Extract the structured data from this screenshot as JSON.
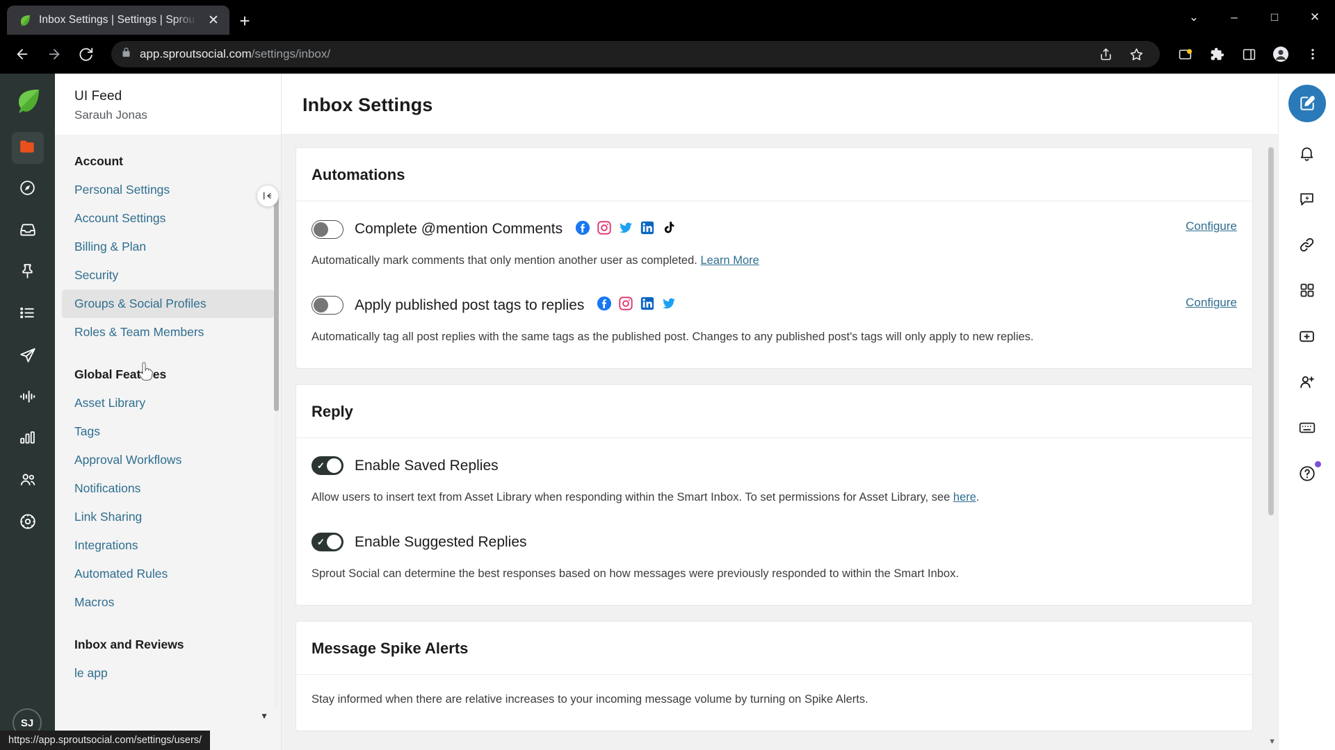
{
  "browser": {
    "tab": {
      "title": "Inbox Settings | Settings | Sprou",
      "favicon": "sprout-leaf-icon",
      "close_label": "✕"
    },
    "new_tab_label": "+",
    "window_controls": {
      "minimize_list": "⌄",
      "minimize": "–",
      "maximize": "□",
      "close": "✕"
    },
    "nav": {
      "back": "←",
      "forward": "→",
      "reload": "↻"
    },
    "omnibox": {
      "lock_icon": "lock-icon",
      "url_domain": "app.sproutsocial.com",
      "url_path": "/settings/inbox/",
      "share_icon": "share-icon",
      "bookmark_icon": "star-icon",
      "extensions_icon": "puzzle-icon",
      "sidepanel_icon": "side-panel-icon",
      "profile_icon": "profile-avatar-icon",
      "menu_icon": "three-dot-menu-icon"
    },
    "status_bar_url": "https://app.sproutsocial.com/settings/users/"
  },
  "left_rail": {
    "logo": "sprout-social-logo",
    "items": [
      {
        "name": "asset-folder",
        "icon": "orange-folder-icon",
        "active": true
      },
      {
        "name": "dashboard",
        "icon": "compass-icon",
        "active": false
      },
      {
        "name": "smart-inbox",
        "icon": "inbox-tray-icon",
        "active": false
      },
      {
        "name": "publishing",
        "icon": "pin-icon",
        "active": false
      },
      {
        "name": "tasks",
        "icon": "list-icon",
        "active": false
      },
      {
        "name": "send",
        "icon": "paper-plane-icon",
        "active": false
      },
      {
        "name": "listening",
        "icon": "audio-waveform-icon",
        "active": false
      },
      {
        "name": "reports",
        "icon": "bar-chart-icon",
        "active": false
      },
      {
        "name": "employee-advocacy",
        "icon": "people-icon",
        "active": false
      },
      {
        "name": "settings",
        "icon": "gear-circle-icon",
        "active": false
      }
    ],
    "avatar_initials": "SJ"
  },
  "settings_nav": {
    "org_name": "UI Feed",
    "user_name": "Sarauh Jonas",
    "collapse_icon": "collapse-panel-icon",
    "groups": [
      {
        "title": "Account",
        "items": [
          {
            "label": "Personal Settings",
            "active": false
          },
          {
            "label": "Account Settings",
            "active": false
          },
          {
            "label": "Billing & Plan",
            "active": false
          },
          {
            "label": "Security",
            "active": false
          },
          {
            "label": "Groups & Social Profiles",
            "active": true
          },
          {
            "label": "Roles & Team Members",
            "active": false
          }
        ]
      },
      {
        "title": "Global Features",
        "items": [
          {
            "label": "Asset Library",
            "active": false
          },
          {
            "label": "Tags",
            "active": false
          },
          {
            "label": "Approval Workflows",
            "active": false
          },
          {
            "label": "Notifications",
            "active": false
          },
          {
            "label": "Link Sharing",
            "active": false
          },
          {
            "label": "Integrations",
            "active": false
          },
          {
            "label": "Automated Rules",
            "active": false
          },
          {
            "label": "Macros",
            "active": false
          }
        ]
      },
      {
        "title": "Inbox and Reviews",
        "items": [
          {
            "label": "le app",
            "active": false
          }
        ]
      }
    ],
    "scroll_caret": "▼"
  },
  "main": {
    "page_title": "Inbox Settings",
    "cards": [
      {
        "title": "Automations",
        "rows": [
          {
            "label": "Complete @mention Comments",
            "toggle": "off",
            "networks": [
              "facebook",
              "instagram",
              "twitter",
              "linkedin",
              "tiktok"
            ],
            "description": "Automatically mark comments that only mention another user as completed.",
            "link_text": "Learn More",
            "action": "Configure"
          },
          {
            "label": "Apply published post tags to replies",
            "toggle": "off",
            "networks": [
              "facebook",
              "instagram",
              "linkedin",
              "twitter"
            ],
            "description": "Automatically tag all post replies with the same tags as the published post. Changes to any published post's tags will only apply to new replies.",
            "link_text": "",
            "action": "Configure"
          }
        ]
      },
      {
        "title": "Reply",
        "rows": [
          {
            "label": "Enable Saved Replies",
            "toggle": "on",
            "networks": [],
            "description": "Allow users to insert text from Asset Library when responding within the Smart Inbox. To set permissions for Asset Library, see",
            "link_text": "here",
            "description_suffix": ".",
            "action": ""
          },
          {
            "label": "Enable Suggested Replies",
            "toggle": "on",
            "networks": [],
            "description": "Sprout Social can determine the best responses based on how messages were previously responded to within the Smart Inbox.",
            "link_text": "",
            "action": ""
          }
        ]
      },
      {
        "title": "Message Spike Alerts",
        "rows": [
          {
            "label": "",
            "toggle": "",
            "networks": [],
            "description": "Stay informed when there are relative increases to your incoming message volume by turning on Spike Alerts.",
            "link_text": "",
            "action": ""
          }
        ]
      }
    ]
  },
  "right_rail": {
    "compose_icon": "compose-pencil-icon",
    "items": [
      {
        "name": "notifications",
        "icon": "bell-icon",
        "badge": false
      },
      {
        "name": "quick-reply",
        "icon": "lightning-chat-icon",
        "badge": false
      },
      {
        "name": "link-shortener",
        "icon": "link-chain-icon",
        "badge": false
      },
      {
        "name": "apps-grid",
        "icon": "grid-squares-icon",
        "badge": false
      },
      {
        "name": "add-item",
        "icon": "plus-box-icon",
        "badge": false
      },
      {
        "name": "invite-user",
        "icon": "person-plus-icon",
        "badge": false
      },
      {
        "name": "keyboard-shortcuts",
        "icon": "keyboard-icon",
        "badge": false
      },
      {
        "name": "help",
        "icon": "question-circle-icon",
        "badge": true
      }
    ]
  },
  "colors": {
    "brand_green": "#51ad32",
    "rail_dark": "#2b3533",
    "link_blue": "#2f6e8f",
    "compose_blue": "#2a7ab9",
    "folder_orange": "#e8501e",
    "facebook": "#1877f2",
    "instagram": "#e1306c",
    "twitter": "#1da1f2",
    "linkedin": "#0a66c2",
    "tiktok": "#000000",
    "badge_purple": "#7b4fd6"
  }
}
